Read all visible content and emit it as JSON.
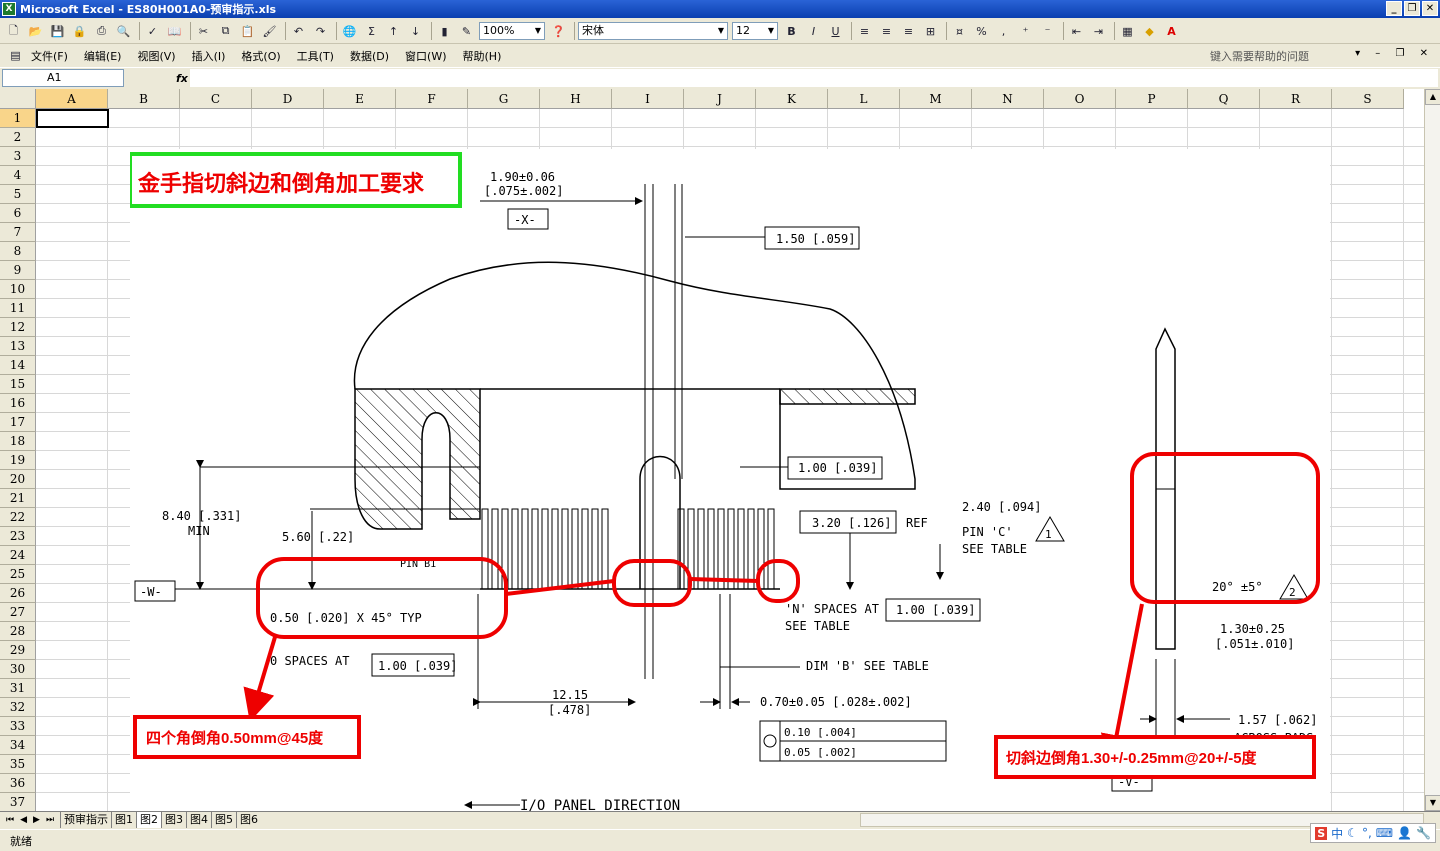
{
  "window": {
    "title": "Microsoft Excel - ES80H001A0-预审指示.xls"
  },
  "toolbar": {
    "zoom": "100%",
    "font_name": "宋体",
    "font_size": "12",
    "bold": "B",
    "italic": "I",
    "underline": "U",
    "percent": "%",
    "comma": ","
  },
  "menu": {
    "items": [
      {
        "label": "文件(F)"
      },
      {
        "label": "编辑(E)"
      },
      {
        "label": "视图(V)"
      },
      {
        "label": "插入(I)"
      },
      {
        "label": "格式(O)"
      },
      {
        "label": "工具(T)"
      },
      {
        "label": "数据(D)"
      },
      {
        "label": "窗口(W)"
      },
      {
        "label": "帮助(H)"
      }
    ],
    "help_placeholder": "键入需要帮助的问题"
  },
  "formula": {
    "name_box": "A1",
    "fx": "fx",
    "content": ""
  },
  "columns": [
    "A",
    "B",
    "C",
    "D",
    "E",
    "F",
    "G",
    "H",
    "I",
    "J",
    "K",
    "L",
    "M",
    "N",
    "O",
    "P",
    "Q",
    "R",
    "S"
  ],
  "rows": [
    "1",
    "2",
    "3",
    "4",
    "5",
    "6",
    "7",
    "8",
    "9",
    "10",
    "11",
    "12",
    "13",
    "14",
    "15",
    "16",
    "17",
    "18",
    "19",
    "20",
    "21",
    "22",
    "23",
    "24",
    "25",
    "26",
    "27",
    "28",
    "29",
    "30",
    "31",
    "32",
    "33",
    "34",
    "35",
    "36",
    "37"
  ],
  "sheet_tabs": [
    "预审指示",
    "图1",
    "图2",
    "图3",
    "图4",
    "图5",
    "图6"
  ],
  "active_tab": "图2",
  "status": {
    "text": "就绪"
  },
  "ime": {
    "logo": "S",
    "lang": "中"
  },
  "drawing": {
    "title": "金手指切斜边和倒角加工要求",
    "callout_left": "四个角倒角0.50mm@45度",
    "callout_right": "切斜边倒角1.30+/-0.25mm@20+/-5度",
    "dims": {
      "top": "1.90±0.06",
      "top2": "[.075±.002]",
      "x_datum": "-X-",
      "d150": "1.50 [.059]",
      "d100": "1.00 [.039]",
      "d840": "8.40 [.331]",
      "min": "MIN",
      "d560": "5.60 [.22]",
      "d320": "3.20 [.126]",
      "ref": "REF",
      "d240": "2.40 [.094]",
      "pin_c": "PIN 'C'",
      "see_table": "SEE TABLE",
      "tri1": "1",
      "pin_b1": "PIN B1",
      "w_datum": "-W-",
      "chamfer": "0.50 [.020] X 45° TYP",
      "n_spaces": "'N' SPACES AT",
      "d100b": "1.00 [.039]",
      "see_table2": "SEE TABLE",
      "spaces_at": "0 SPACES AT",
      "d100c": "1.00 [.039]",
      "dim_b": "DIM 'B'  SEE TABLE",
      "d1215": "12.15",
      "d478": "[.478]",
      "d070": "0.70±0.05 [.028±.002]",
      "tol1": "0.10 [.004]",
      "tol2": "0.05 [.002]",
      "angle": "20° ±5°",
      "tri2": "2",
      "d130": "1.30±0.25",
      "d051": "[.051±.010]",
      "d157": "1.57 [.062]",
      "across": "ACROSS PADS",
      "v_datum": "-V-",
      "io": "I/O PANEL DIRECTION"
    }
  }
}
